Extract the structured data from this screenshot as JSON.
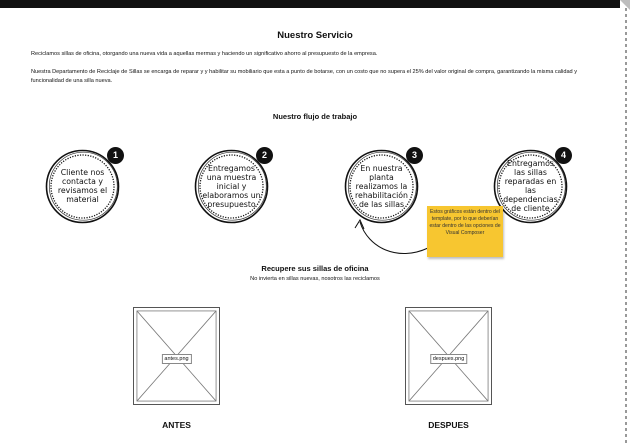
{
  "page": {
    "title": "Nuestro Servicio",
    "paragraph_1": "Reciclamos sillas de oficina, otorgando una nueva vida a aquellas mermas y haciendo un significativo ahorro al presupuesto de la empresa.",
    "paragraph_2": "Nuestra Departamento de Reciclaje de Sillas se encarga de reparar y y habilitar su mobiliario que esta a punto de botarse, con un costo que no supera el 25% del valor original de compra, garantizando la misma calidad y funcionalidad de una silla nueva."
  },
  "workflow": {
    "title": "Nuestro flujo de trabajo",
    "steps": [
      {
        "number": "1",
        "text": "Cliente nos contacta y revisamos el material"
      },
      {
        "number": "2",
        "text": "Entregamos una muestra inicial y elaboramos un presupuesto"
      },
      {
        "number": "3",
        "text": "En nuestra planta realizamos la rehabilitación de las sillas"
      },
      {
        "number": "4",
        "text": "Entregamos las sillas reparadas en las dependencias de cliente"
      }
    ],
    "note": "Estos gráficos están dentro del template, por lo que deberían estar dentro de las opciones de Visual Composer",
    "note_color": "#f7c630"
  },
  "recover": {
    "title": "Recupere sus sillas de oficina",
    "subtitle": "No invierta en sillas nuevas, nosotros las reciclamos",
    "images": [
      {
        "file": "antes.png",
        "caption": "ANTES"
      },
      {
        "file": "despues.png",
        "caption": "DESPUES"
      }
    ]
  }
}
